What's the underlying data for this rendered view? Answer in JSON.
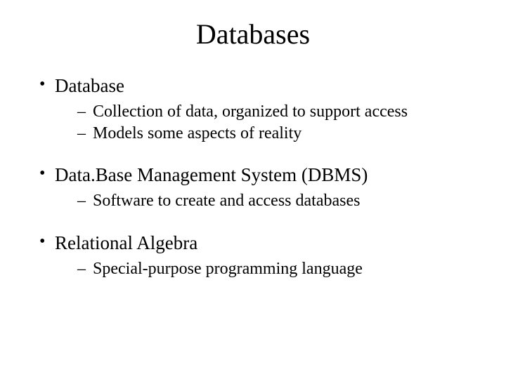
{
  "title": "Databases",
  "items": [
    {
      "label": "Database",
      "subitems": [
        "Collection of data, organized to support access",
        "Models some aspects of reality"
      ]
    },
    {
      "label": "Data.Base Management System (DBMS)",
      "subitems": [
        "Software to create and access databases"
      ]
    },
    {
      "label": "Relational Algebra",
      "subitems": [
        "Special-purpose programming language"
      ]
    }
  ]
}
